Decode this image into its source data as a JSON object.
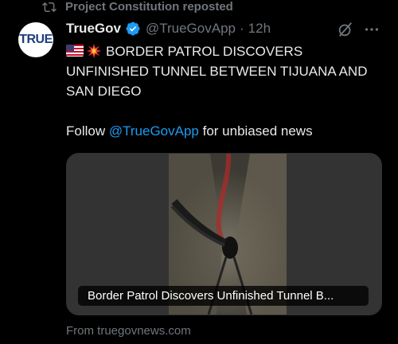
{
  "repost": {
    "icon": "repost-icon",
    "text": "Project Constitution reposted"
  },
  "post": {
    "avatar_text": "TRUE",
    "author_name": "TrueGov",
    "verified_icon": "verified-badge-icon",
    "handle": "@TrueGovApp",
    "separator": "·",
    "time": "12h",
    "headline": "BORDER PATROL DISCOVERS UNFINISHED TUNNEL BETWEEN TIJUANA AND SAN DIEGO",
    "follow_prefix": "Follow ",
    "follow_link": "@TrueGovApp",
    "follow_suffix": " for unbiased news"
  },
  "card": {
    "title": "Border Patrol Discovers Unfinished Tunnel B...",
    "source": "From truegovnews.com"
  },
  "colors": {
    "background": "#000000",
    "text": "#e7e9ea",
    "muted": "#71767b",
    "link": "#1d9bf0"
  }
}
